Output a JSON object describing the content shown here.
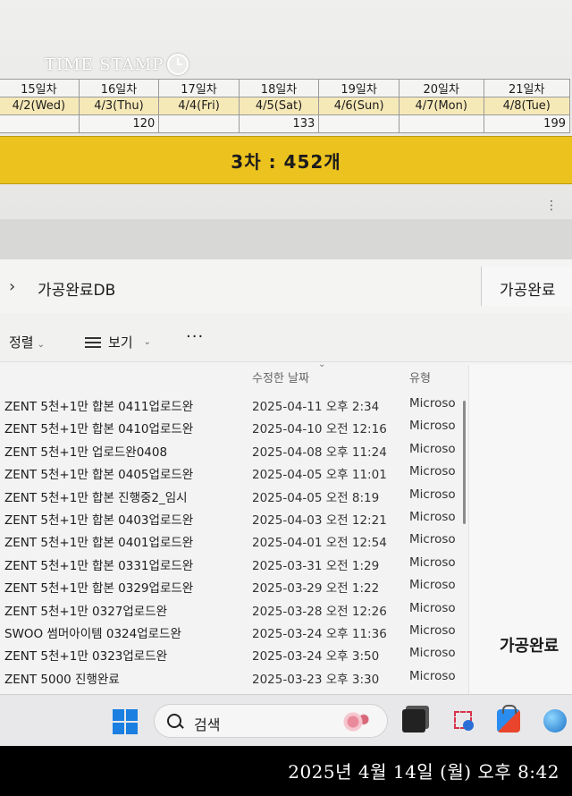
{
  "watermark": {
    "text": "TIME STAMP"
  },
  "sheet": {
    "days": [
      "15일차",
      "16일차",
      "17일차",
      "18일차",
      "19일차",
      "20일차",
      "21일차"
    ],
    "dates": [
      "4/2(Wed)",
      "4/3(Thu)",
      "4/4(Fri)",
      "4/5(Sat)",
      "4/6(Sun)",
      "4/7(Mon)",
      "4/8(Tue)"
    ],
    "values": [
      "",
      "120",
      "",
      "133",
      "",
      "",
      "199"
    ],
    "banner": "3차 : 452개"
  },
  "explorer": {
    "breadcrumb": "가공완료DB",
    "side_crumb": "가공완료",
    "toolbar": {
      "sort": "정렬",
      "view": "보기",
      "more": "···"
    },
    "columns": {
      "date": "수정한 날짜",
      "type": "유형"
    },
    "rows": [
      {
        "name": "ZENT 5천+1만 합본 0411업로드완",
        "date": "2025-04-11 오후 2:34",
        "type": "Microso"
      },
      {
        "name": "ZENT 5천+1만 합본 0410업로드완",
        "date": "2025-04-10 오전 12:16",
        "type": "Microso"
      },
      {
        "name": "ZENT 5천+1만 업로드완0408",
        "date": "2025-04-08 오후 11:24",
        "type": "Microso"
      },
      {
        "name": "ZENT 5천+1만 합본 0405업로드완",
        "date": "2025-04-05 오후 11:01",
        "type": "Microso"
      },
      {
        "name": "ZENT 5천+1만 합본 진행중2_임시",
        "date": "2025-04-05 오전 8:19",
        "type": "Microso"
      },
      {
        "name": "ZENT 5천+1만 합본 0403업로드완",
        "date": "2025-04-03 오전 12:21",
        "type": "Microso"
      },
      {
        "name": "ZENT 5천+1만 합본 0401업로드완",
        "date": "2025-04-01 오전 12:54",
        "type": "Microso"
      },
      {
        "name": "ZENT 5천+1만 합본 0331업로드완",
        "date": "2025-03-31 오전 1:29",
        "type": "Microso"
      },
      {
        "name": "ZENT 5천+1만 합본 0329업로드완",
        "date": "2025-03-29 오전 1:22",
        "type": "Microso"
      },
      {
        "name": "ZENT 5천+1만 0327업로드완",
        "date": "2025-03-28 오전 12:26",
        "type": "Microso"
      },
      {
        "name": "SWOO 썸머아이템 0324업로드완",
        "date": "2025-03-24 오후 11:36",
        "type": "Microso"
      },
      {
        "name": "ZENT 5천+1만 0323업로드완",
        "date": "2025-03-24 오후 3:50",
        "type": "Microso"
      },
      {
        "name": "ZENT 5000 진행완료",
        "date": "2025-03-23 오후 3:30",
        "type": "Microso"
      }
    ],
    "right_title": "가공완료"
  },
  "taskbar": {
    "search_label": "검색"
  },
  "timestamp": "2025년 4월 14일 (월)  오후 8:42",
  "colors": {
    "banner": "#ecc21f",
    "date_row": "#f6e9b8",
    "accent": "#1a7fe0"
  }
}
